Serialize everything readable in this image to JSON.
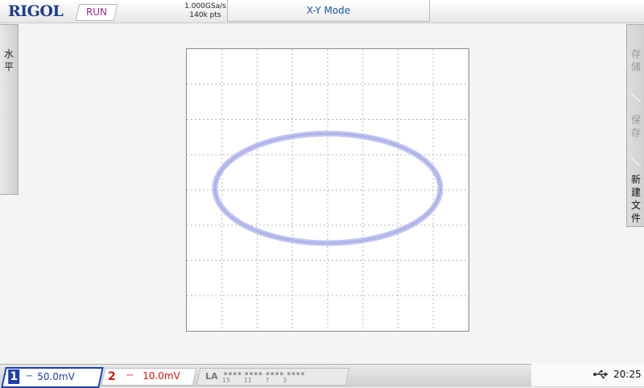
{
  "header": {
    "brand": "RIGOL",
    "run_status": "RUN",
    "sample_rate": "1.000GSa/s",
    "memory_depth": "140k pts",
    "mode_title": "X-Y Mode"
  },
  "left_menu": {
    "label": "水平"
  },
  "right_menu": {
    "items": [
      "存储",
      "保存",
      "新建文件"
    ]
  },
  "bottom": {
    "ch1": {
      "number": "1",
      "coupling": "⎓",
      "scale": "50.0mV"
    },
    "ch2": {
      "number": "2",
      "coupling": "⎓",
      "scale": "10.0mV"
    },
    "la": {
      "label": "LA",
      "channel_marks": "15 11 7 3"
    },
    "usb_icon": "usb-icon",
    "time": "20:25"
  },
  "colors": {
    "trace": "#b4b8ec",
    "ch1": "#1e3fae",
    "ch2": "#dd1111",
    "brand": "#1d3c8f",
    "run": "#9b2a9b"
  }
}
